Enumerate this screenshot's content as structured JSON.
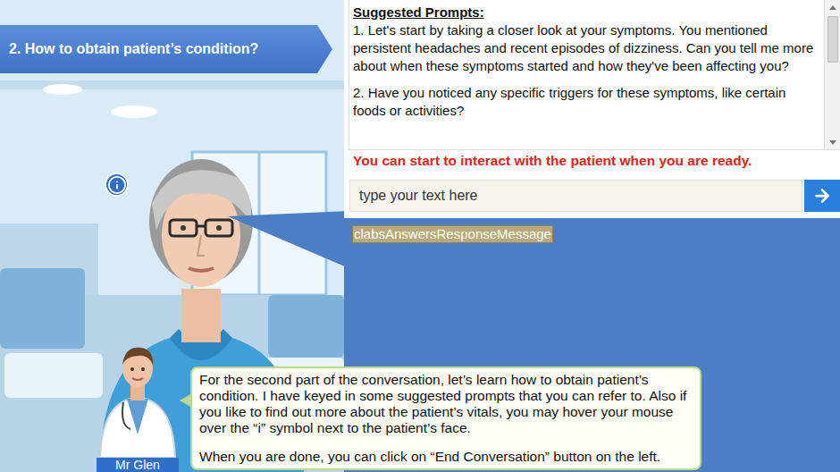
{
  "lesson": {
    "title": "2. How to obtain patient’s condition?"
  },
  "prompts": {
    "heading": "Suggested Prompts:",
    "items": [
      "1. Let's start by taking a closer look at your symptoms. You mentioned persistent headaches and recent episodes of dizziness. Can you tell me more about when these symptoms started and how they've been affecting you?",
      "2. Have you noticed any specific triggers for these symptoms, like certain foods or activities?"
    ]
  },
  "notice": "You can start to interact with the patient when you are ready.",
  "chat_input": {
    "placeholder": "type your text here"
  },
  "response": {
    "message": "clabsAnswersResponseMessage"
  },
  "tutor": {
    "name": "Mr Glen",
    "paragraphs": [
      "For the second part of the conversation, let’s learn how to obtain patient’s condition. I have keyed in some suggested prompts that you can refer to. Also if you like to find out more about the patient’s vitals, you may hover your mouse over the “i” symbol next to the patient’s face.",
      "When you are done, you can click on “End Conversation” button on the left."
    ]
  }
}
